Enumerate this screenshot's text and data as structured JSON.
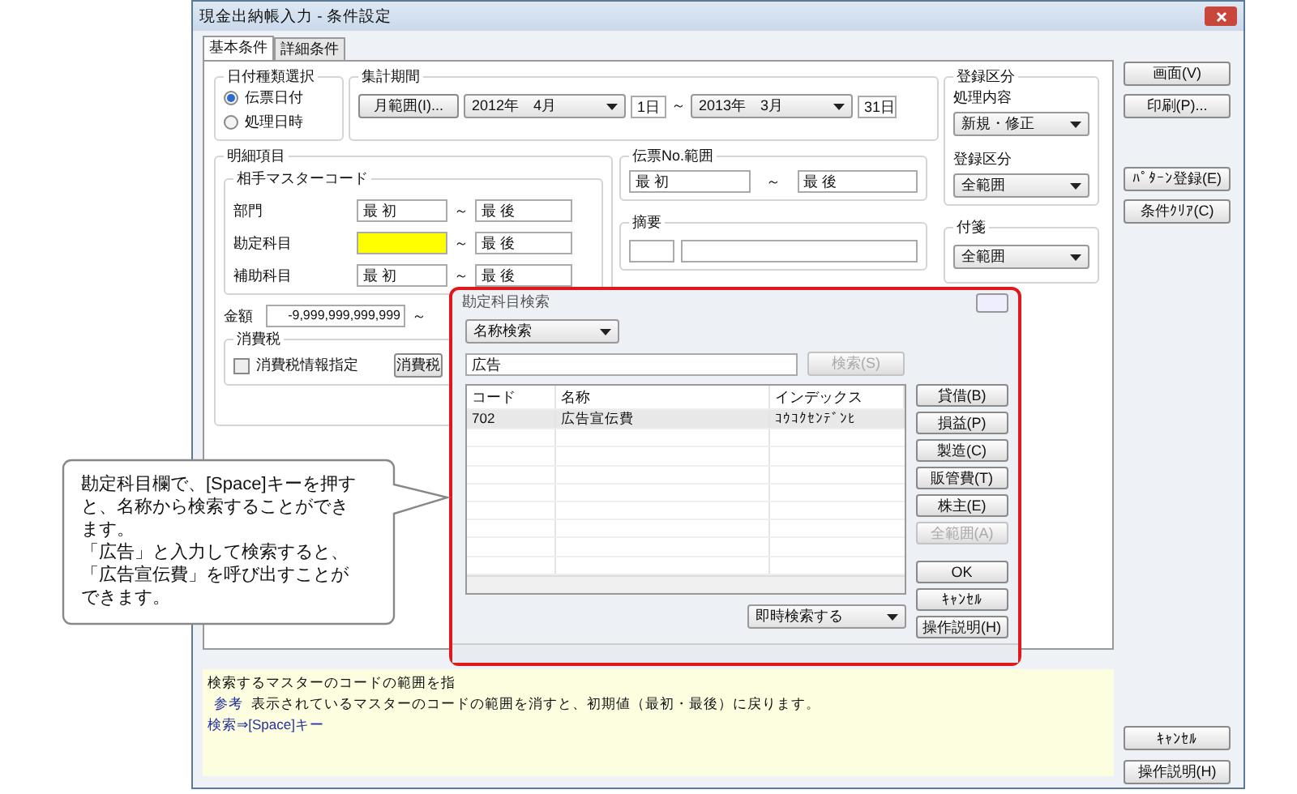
{
  "window": {
    "title": "現金出納帳入力 - 条件設定"
  },
  "tabs": [
    {
      "label": "基本条件",
      "selected": true
    },
    {
      "label": "詳細条件",
      "selected": false
    }
  ],
  "date_type": {
    "label": "日付種類選択",
    "options": [
      {
        "label": "伝票日付",
        "selected": true
      },
      {
        "label": "処理日時",
        "selected": false
      }
    ]
  },
  "period": {
    "label": "集計期間",
    "range_button": "月範囲(I)...",
    "from_month": "2012年　4月",
    "from_day": "1日",
    "separator": "～",
    "to_month": "2013年　3月",
    "to_day": "31日"
  },
  "details": {
    "label": "明細項目",
    "master_code": {
      "label": "相手マスターコード",
      "rows": [
        {
          "label": "部門",
          "from": "最 初",
          "separator": "～",
          "to": "最 後",
          "focused": false
        },
        {
          "label": "勘定科目",
          "separator": "～",
          "to": "最 後",
          "focused": true
        },
        {
          "label": "補助科目",
          "from": "最 初",
          "separator": "～",
          "to": "最 後",
          "focused": false
        }
      ]
    },
    "amount": {
      "label": "金額",
      "from": "-9,999,999,999,999",
      "separator": "～"
    },
    "tax": {
      "label": "消費税",
      "checkbox": {
        "label": "消費税情報指定",
        "checked": false
      },
      "button": "消費税"
    }
  },
  "slip_range": {
    "label": "伝票No.範囲",
    "from": "最 初",
    "separator": "～",
    "to": "最 後"
  },
  "summary": {
    "label": "摘要"
  },
  "registration": {
    "label": "登録区分",
    "process_label": "処理内容",
    "process_value": "新規・修正",
    "category_label": "登録区分",
    "category_value": "全範囲"
  },
  "sticky_note": {
    "label": "付箋",
    "value": "全範囲"
  },
  "side_buttons": [
    "画面(V)",
    "印刷(P)...",
    "ﾊﾟﾀｰﾝ登録(E)",
    "条件ｸﾘｱ(C)"
  ],
  "help": {
    "line_1": "検索するマスターのコードの範囲を指",
    "note_label": "参考",
    "note_text": "表示されているマスターのコードの範囲を消すと、初期値（最初・最後）に戻ります。",
    "shortcut": "検索⇒[Space]キー"
  },
  "bottom_buttons": [
    "ｷｬﾝｾﾙ",
    "操作説明(H)"
  ],
  "search_dialog": {
    "title": "勘定科目検索",
    "mode": "名称検索",
    "query": "広告",
    "search_button": {
      "label": "検索(S)",
      "disabled": true
    },
    "columns": [
      "コード",
      "名称",
      "インデックス"
    ],
    "rows": [
      {
        "cells": [
          "702",
          "広告宣伝費",
          "ｺｳｺｸｾﾝﾃﾞﾝﾋ"
        ],
        "selected": true
      }
    ],
    "filter_buttons": [
      {
        "label": "貸借(B)",
        "disabled": false
      },
      {
        "label": "損益(P)",
        "disabled": false
      },
      {
        "label": "製造(C)",
        "disabled": false
      },
      {
        "label": "販管費(T)",
        "disabled": false
      },
      {
        "label": "株主(E)",
        "disabled": false
      },
      {
        "label": "全範囲(A)",
        "disabled": true
      }
    ],
    "action_buttons": [
      "OK",
      "ｷｬﾝｾﾙ",
      "操作説明(H)"
    ],
    "instant_search": "即時検索する"
  },
  "callout": {
    "paragraphs": [
      "勘定科目欄で、[Space]キーを押すと、名称から検索することができます。",
      "「広告」と入力して検索すると、「広告宣伝費」を呼び出すことができます。"
    ]
  }
}
